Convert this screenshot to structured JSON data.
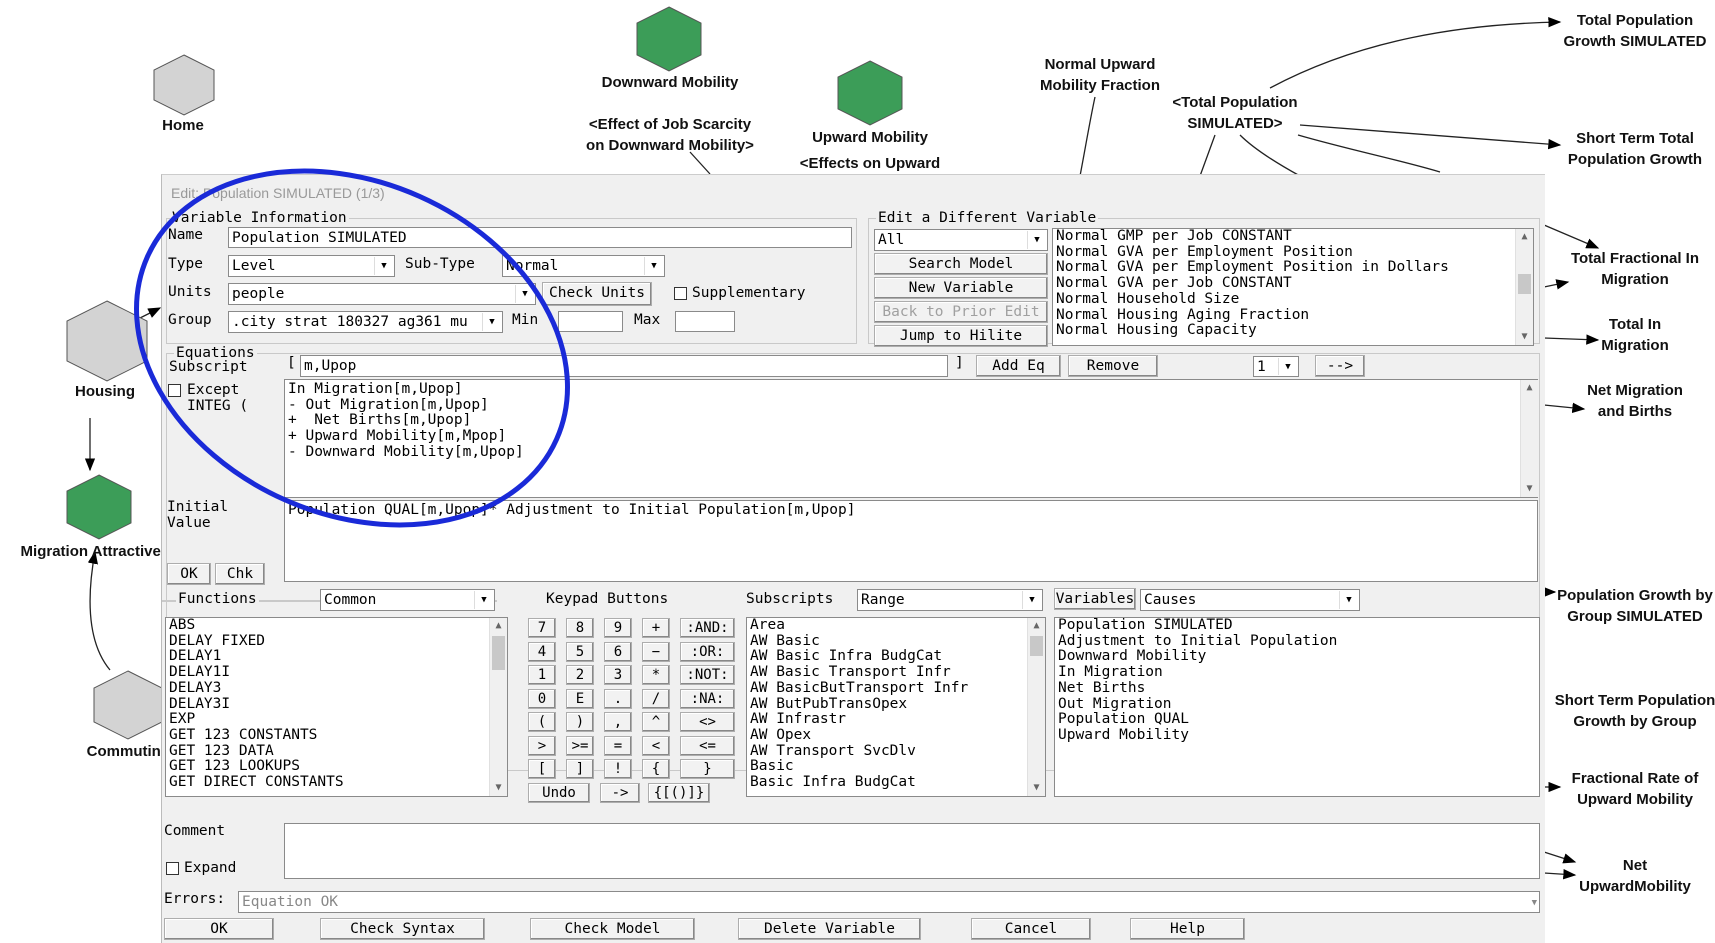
{
  "diagram": {
    "labels": {
      "home": "Home",
      "downward_mobility": "Downward Mobility",
      "effect_job_scarcity": "<Effect of Job Scarcity\non Downward Mobility>",
      "upward_mobility": "Upward Mobility",
      "effects_on_upward": "<Effects on Upward",
      "normal_upward_fraction": "Normal Upward\nMobility Fraction",
      "total_population_simulated": "<Total Population\nSIMULATED>",
      "total_population_growth_simulated": "Total Population\nGrowth SIMULATED",
      "short_term_total_growth": "Short Term Total\nPopulation Growth",
      "total_fractional_in_migration": "Total Fractional In\nMigration",
      "total_in_migration": "Total In\nMigration",
      "net_migration_births": "Net Migration\nand Births",
      "population_growth_by_group": "Population Growth by\nGroup SIMULATED",
      "short_term_growth_by_group": "Short Term Population\nGrowth by Group",
      "fractional_rate_upward": "Fractional Rate of\nUpward Mobility",
      "net_upward_mobility": "Net\nUpwardMobility",
      "housing": "Housing",
      "migration_attractiveness": "Migration Attractiven",
      "commuting": "Commuting"
    },
    "colors": {
      "gray_hex": "#d3d3d3",
      "green_hex": "#3c9d58",
      "highlight_circle": "#1a2ad8"
    }
  },
  "dialog": {
    "title": "Edit: Population SIMULATED (1/3)",
    "variable_info": {
      "section_title": "Variable Information",
      "name_label": "Name",
      "name_value": "Population SIMULATED",
      "type_label": "Type",
      "type_value": "Level",
      "subtype_label": "Sub-Type",
      "subtype_value": "Normal",
      "units_label": "Units",
      "units_value": "people",
      "check_units": "Check Units",
      "supplementary": "Supplementary",
      "group_label": "Group",
      "group_value": ".city strat 180327 ag361 mu",
      "min_label": "Min",
      "max_label": "Max"
    },
    "edit_different": {
      "section_title": "Edit a Different Variable",
      "filter_value": "All",
      "search_model": "Search Model",
      "new_variable": "New Variable",
      "back_prior": "Back to Prior Edit",
      "jump_hilite": "Jump to Hilite",
      "variables": [
        "Normal GMP per Job CONSTANT",
        "Normal GVA per Employment Position",
        "Normal GVA per Employment Position in Dollars",
        "Normal GVA per Job CONSTANT",
        "Normal Household Size",
        "Normal Housing Aging Fraction",
        "Normal Housing Capacity"
      ]
    },
    "equations": {
      "section_title": "Equations",
      "subscript_label": "Subscript",
      "subscript_open": "[",
      "subscript_value": "m,Upop",
      "subscript_close": "]",
      "add_eq": "Add Eq",
      "remove": "Remove",
      "eq_index": "1",
      "next": "-->",
      "except": "Except",
      "integ": "INTEG (",
      "equation_text": "In Migration[m,Upop]\n- Out Migration[m,Upop]\n+  Net Births[m,Upop]\n+ Upward Mobility[m,Mpop]\n- Downward Mobility[m,Upop]",
      "initial_label": "Initial\nValue",
      "initial_value": "Population QUAL[m,Upop]* Adjustment to Initial Population[m,Upop]",
      "ok": "OK",
      "chk": "Chk"
    },
    "functions": {
      "label": "Functions",
      "filter": "Common",
      "items": [
        "ABS",
        "DELAY FIXED",
        "DELAY1",
        "DELAY1I",
        "DELAY3",
        "DELAY3I",
        "EXP",
        "GET 123 CONSTANTS",
        "GET 123 DATA",
        "GET 123 LOOKUPS",
        "GET DIRECT CONSTANTS"
      ]
    },
    "keypad": {
      "label": "Keypad Buttons",
      "rows": [
        [
          "7",
          "8",
          "9",
          "+",
          ":AND:"
        ],
        [
          "4",
          "5",
          "6",
          "−",
          ":OR:"
        ],
        [
          "1",
          "2",
          "3",
          "*",
          ":NOT:"
        ],
        [
          "0",
          "E",
          ".",
          "/",
          ":NA:"
        ],
        [
          "(",
          ")",
          ",",
          "^",
          "<>"
        ],
        [
          ">",
          ">=",
          "=",
          "<",
          "<="
        ],
        [
          "[",
          "]",
          "!",
          "{",
          "}"
        ]
      ],
      "undo": "Undo",
      "arrow": "->",
      "braces": "{[()]}"
    },
    "subscripts": {
      "label": "Subscripts",
      "filter": "Range",
      "items": [
        "Area",
        "AW Basic",
        "AW Basic Infra BudgCat",
        "AW Basic Transport Infr",
        "AW BasicButTransport Infr",
        "AW ButPubTransOpex",
        "AW Infrastr",
        "AW Opex",
        "AW Transport SvcDlv",
        "Basic",
        "Basic Infra BudgCat"
      ]
    },
    "variables": {
      "label": "Variables",
      "filter": "Causes",
      "items": [
        "Population SIMULATED",
        "Adjustment to Initial Population",
        "Downward Mobility",
        "In Migration",
        "Net Births",
        "Out Migration",
        "Population QUAL",
        "Upward Mobility"
      ]
    },
    "comment_label": "Comment",
    "expand": "Expand",
    "errors_label": "Errors:",
    "errors_value": "Equation OK",
    "buttons": {
      "ok": "OK",
      "check_syntax": "Check Syntax",
      "check_model": "Check Model",
      "delete_variable": "Delete Variable",
      "cancel": "Cancel",
      "help": "Help"
    }
  }
}
